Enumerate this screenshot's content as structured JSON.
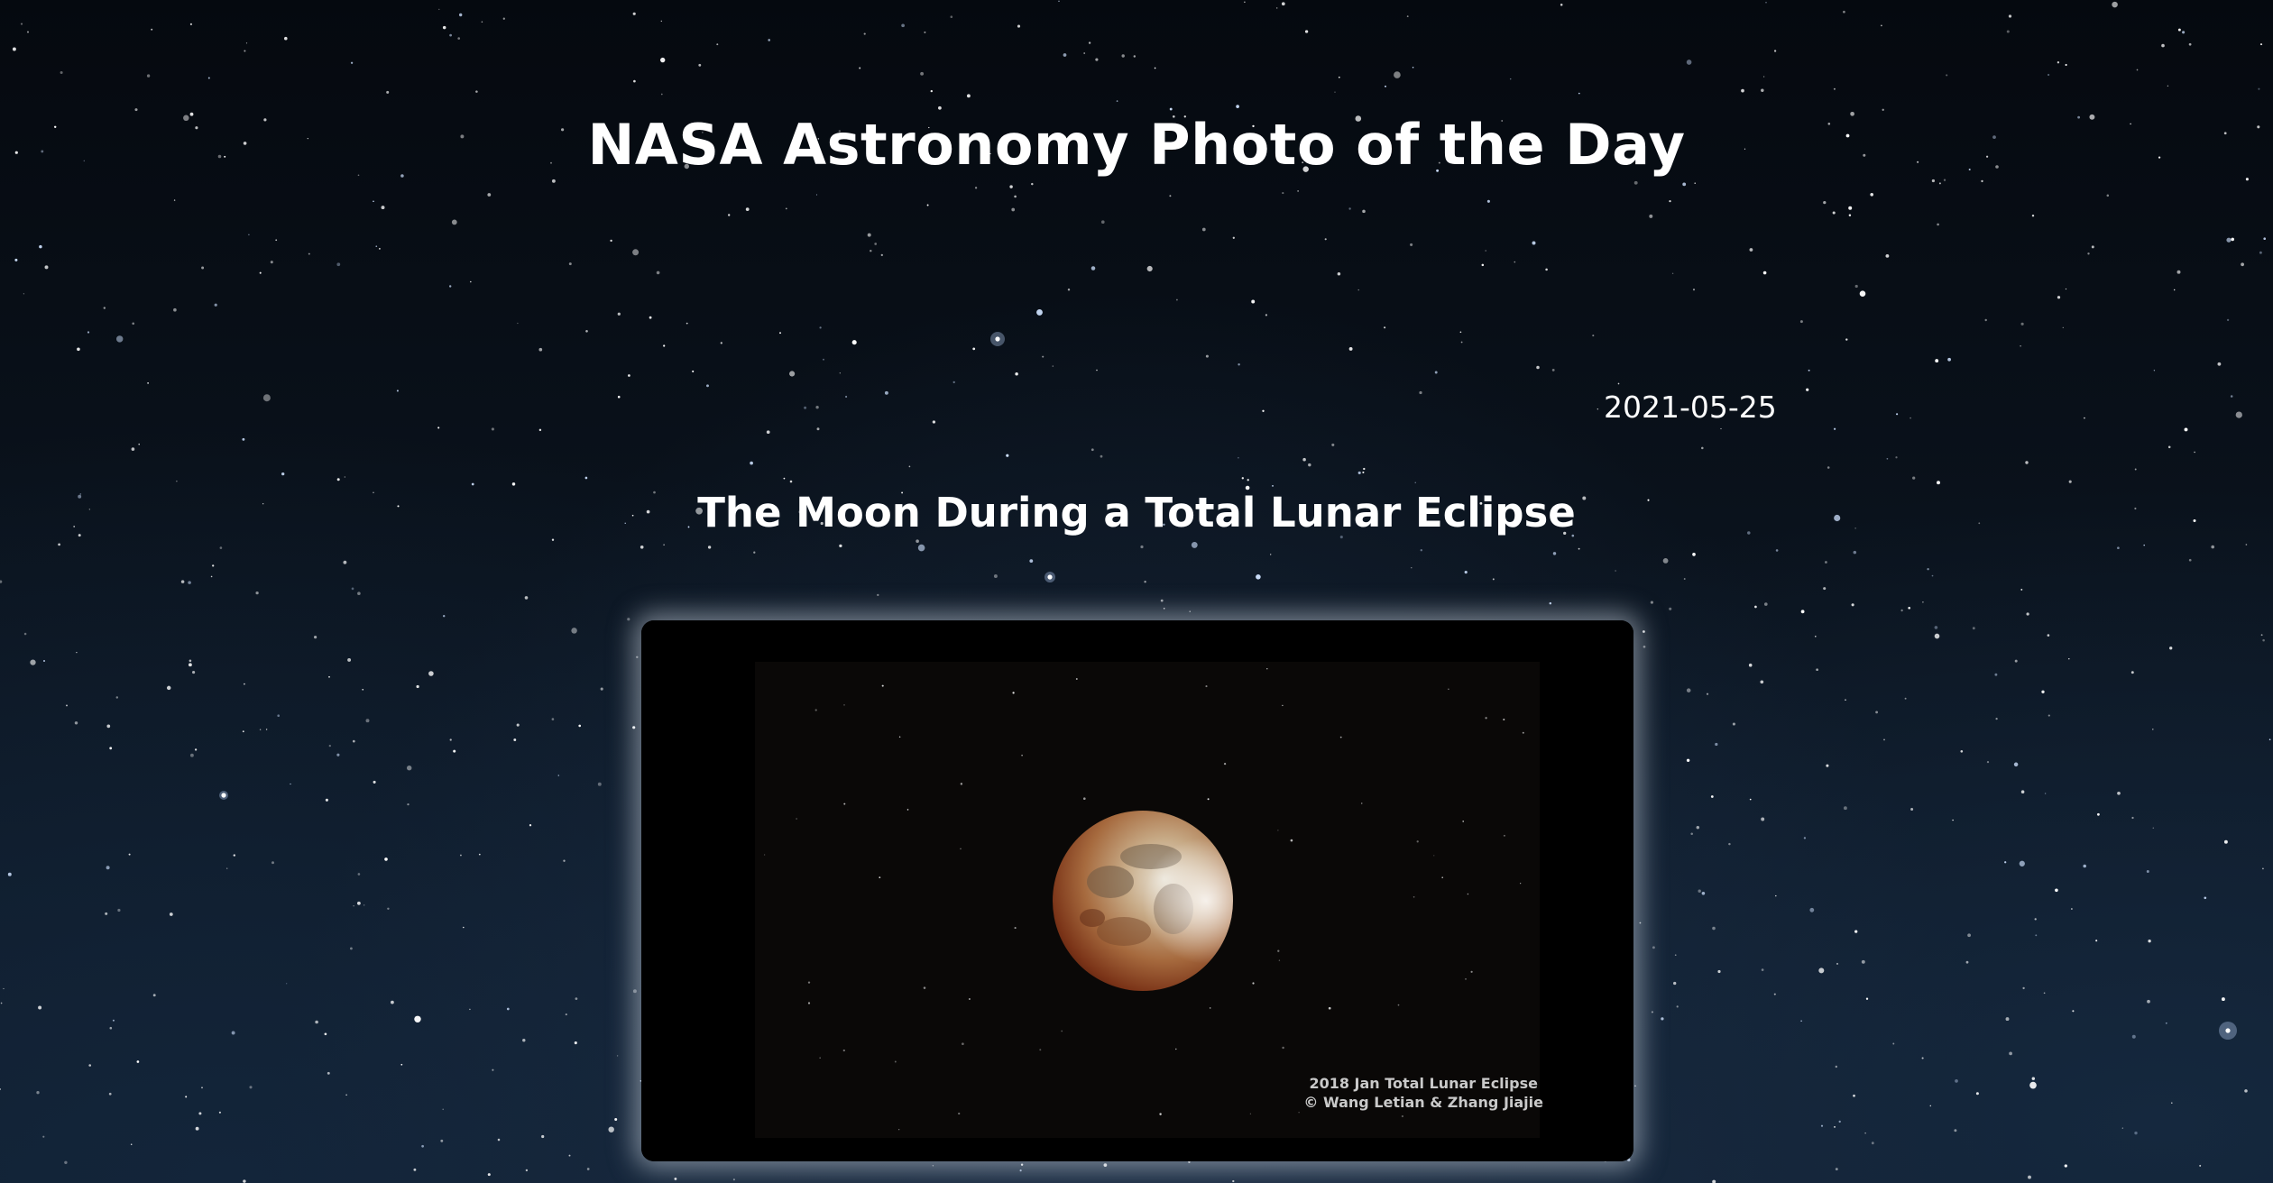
{
  "header": {
    "title": "NASA Astronomy Photo of the Day"
  },
  "apod": {
    "date": "2021-05-25",
    "title": "The Moon During a Total Lunar Eclipse",
    "image": {
      "caption_line1": "2018 Jan Total Lunar Eclipse",
      "caption_line2": "© Wang Letian & Zhang Jiajie"
    }
  },
  "colors": {
    "background": "#0b1420",
    "text": "#ffffff",
    "frame_glow": "#c8d2dc"
  }
}
